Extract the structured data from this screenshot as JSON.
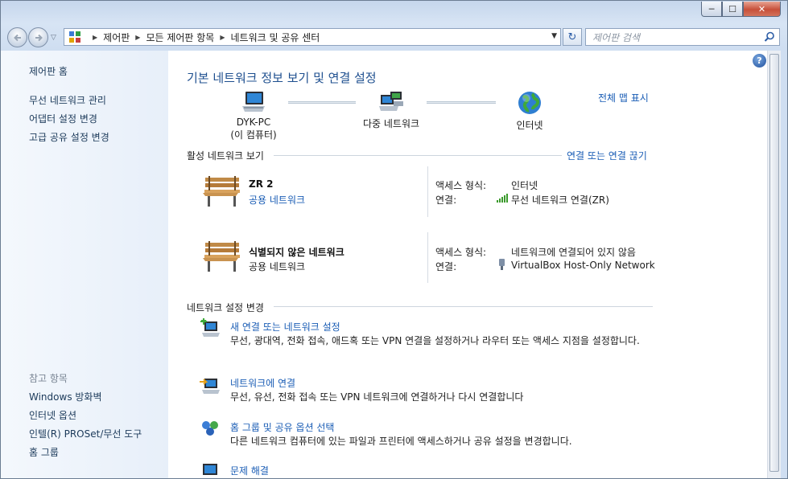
{
  "window": {
    "controls": {
      "minimize": "─",
      "maximize": "☐",
      "close": "✕"
    }
  },
  "nav": {
    "back_icon": "back-arrow-icon",
    "forward_icon": "forward-arrow-icon",
    "dropdown": "▽"
  },
  "address": {
    "crumbs": [
      "제어판",
      "모든 제어판 항목",
      "네트워크 및 공유 센터"
    ],
    "separator": "▶",
    "dropdown": "▼",
    "refresh_label": "↻"
  },
  "search": {
    "placeholder": "제어판 검색"
  },
  "sidebar": {
    "home": "제어판 홈",
    "links": [
      "무선 네트워크 관리",
      "어댑터 설정 변경",
      "고급 공유 설정 변경"
    ],
    "see_also_title": "참고 항목",
    "see_also": [
      "Windows 방화벽",
      "인터넷 옵션",
      "인텔(R) PROSet/무선 도구",
      "홈 그룹"
    ]
  },
  "main": {
    "help": "?",
    "title": "기본 네트워크 정보 보기 및 연결 설정",
    "full_map": "전체 맵 표시",
    "map": {
      "pc_name": "DYK-PC",
      "pc_sub": "(이 컴퓨터)",
      "network": "다중 네트워크",
      "internet": "인터넷"
    },
    "active_title": "활성 네트워크 보기",
    "connect_disconnect": "연결 또는 연결 끊기",
    "networks": [
      {
        "name": "ZR  2",
        "type": "공용 네트워크",
        "type_is_link": true,
        "access_label": "액세스 형식:",
        "access_value": "인터넷",
        "conn_label": "연결:",
        "conn_value": "무선 네트워크 연결(ZR)"
      },
      {
        "name": "식별되지 않은 네트워크",
        "type": "공용 네트워크",
        "type_is_link": false,
        "access_label": "액세스 형식:",
        "access_value": "네트워크에 연결되어 있지 않음",
        "conn_label": "연결:",
        "conn_value": "VirtualBox Host-Only Network"
      }
    ],
    "change_title": "네트워크 설정 변경",
    "tasks": [
      {
        "link": "새 연결 또는 네트워크 설정",
        "desc": "무선, 광대역, 전화 접속, 애드혹 또는 VPN 연결을 설정하거나 라우터 또는 액세스 지점을 설정합니다."
      },
      {
        "link": "네트워크에 연결",
        "desc": "무선, 유선, 전화 접속 또는 VPN 네트워크에 연결하거나 다시 연결합니다"
      },
      {
        "link": "홈 그룹 및 공유 옵션 선택",
        "desc": "다른 네트워크 컴퓨터에 있는 파일과 프린터에 액세스하거나 공유 설정을 변경합니다."
      },
      {
        "link": "문제 해결",
        "desc": ""
      }
    ]
  },
  "colors": {
    "link": "#1a5db5",
    "title": "#1e4f8f",
    "sidebar_bg": "#eef3fa"
  }
}
